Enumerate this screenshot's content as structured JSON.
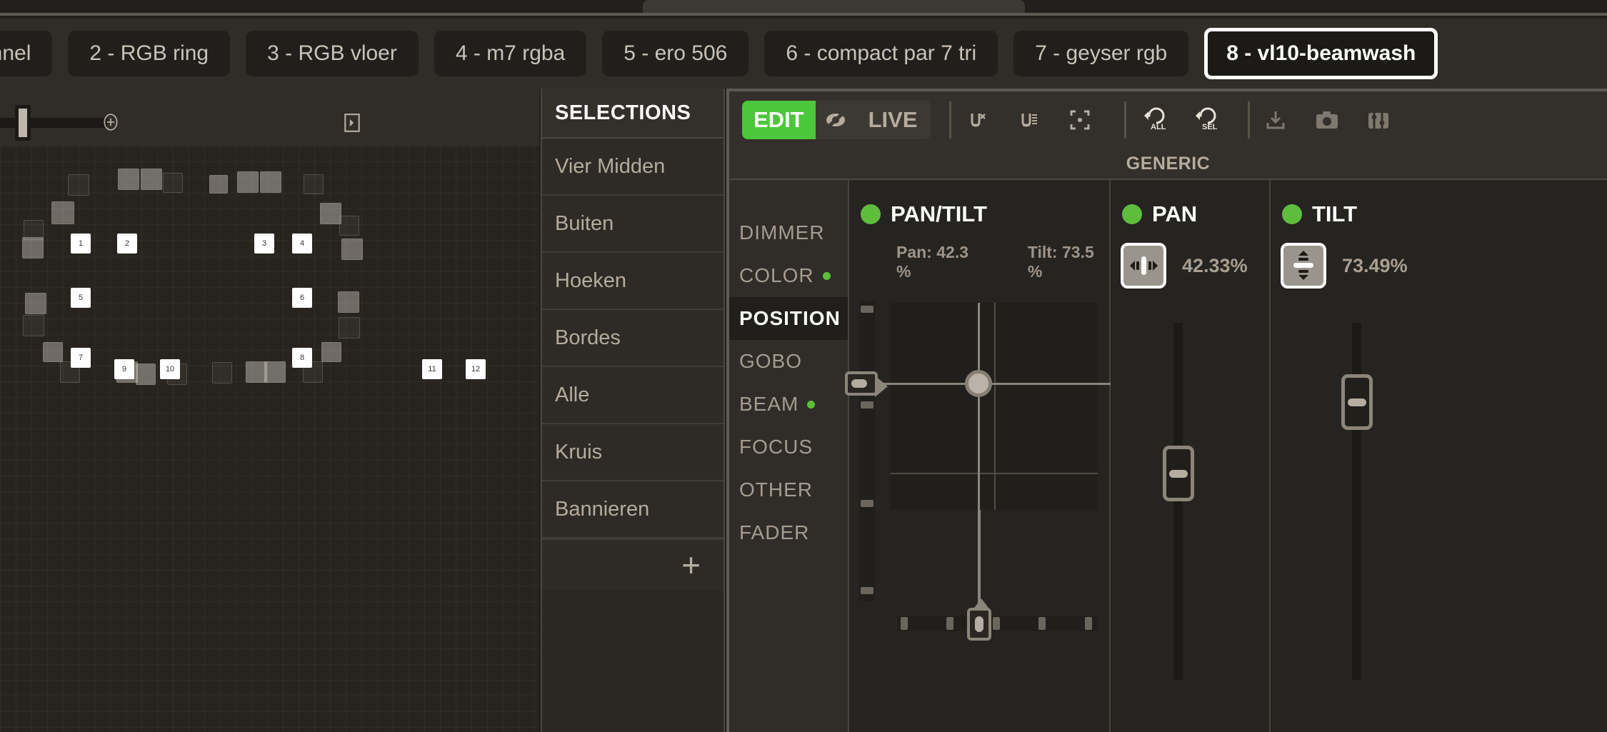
{
  "tabs": [
    {
      "label": "annel",
      "active": false,
      "truncated": true
    },
    {
      "label": "2 - RGB ring",
      "active": false
    },
    {
      "label": "3 - RGB vloer",
      "active": false
    },
    {
      "label": "4 - m7 rgba",
      "active": false
    },
    {
      "label": "5 - ero 506",
      "active": false
    },
    {
      "label": "6 - compact par 7 tri",
      "active": false
    },
    {
      "label": "7 - geyser rgb",
      "active": false
    },
    {
      "label": "8 - vl10-beamwash",
      "active": true
    }
  ],
  "stage": {
    "zoom_slider": {
      "icon_zoom_in": "plus-circle-icon",
      "icon_panel": "panel-toggle-icon",
      "value_pct": 27
    },
    "fixtures_selected": [
      "1",
      "2",
      "3",
      "4",
      "5",
      "6",
      "7",
      "8",
      "9",
      "10",
      "11",
      "12"
    ]
  },
  "selections": {
    "title": "SELECTIONS",
    "items": [
      {
        "label": "Vier Midden"
      },
      {
        "label": "Buiten"
      },
      {
        "label": "Hoeken"
      },
      {
        "label": "Bordes"
      },
      {
        "label": "Alle"
      },
      {
        "label": "Kruis"
      },
      {
        "label": "Bannieren"
      }
    ],
    "add_label": "+"
  },
  "editor": {
    "toolbar": {
      "edit_label": "EDIT",
      "live_label": "LIVE",
      "eye_icon": "eye-slash-icon",
      "mode_active": "EDIT",
      "icons": [
        {
          "name": "blind-off-icon"
        },
        {
          "name": "blind-on-icon"
        },
        {
          "name": "select-frame-icon"
        },
        {
          "name": "undo-all-icon",
          "label": "ALL"
        },
        {
          "name": "undo-selected-icon",
          "label": "SEL"
        },
        {
          "name": "download-icon"
        },
        {
          "name": "camera-icon"
        },
        {
          "name": "settings-sliders-icon"
        }
      ]
    },
    "generic_label": "GENERIC",
    "attributes": [
      {
        "label": "DIMMER",
        "has_dot": false,
        "active": false
      },
      {
        "label": "COLOR",
        "has_dot": true,
        "active": false
      },
      {
        "label": "POSITION",
        "has_dot": true,
        "active": true
      },
      {
        "label": "GOBO",
        "has_dot": false,
        "active": false
      },
      {
        "label": "BEAM",
        "has_dot": true,
        "active": false
      },
      {
        "label": "FOCUS",
        "has_dot": false,
        "active": false
      },
      {
        "label": "OTHER",
        "has_dot": false,
        "active": false
      },
      {
        "label": "FADER",
        "has_dot": false,
        "active": false
      }
    ],
    "pantilt": {
      "title": "PAN/TILT",
      "led_color": "#5fbd3e",
      "pan_readout": "Pan: 42.3 %",
      "tilt_readout": "Tilt: 73.5 %",
      "pan_pct": 42.3,
      "tilt_pct": 73.5
    },
    "pan": {
      "title": "PAN",
      "led_color": "#5fbd3e",
      "button_icon": "pan-left-right-icon",
      "value": "42.33%",
      "value_pct": 42.33
    },
    "tilt": {
      "title": "TILT",
      "led_color": "#5fbd3e",
      "button_icon": "tilt-up-down-icon",
      "value": "73.49%",
      "value_pct": 73.49
    }
  },
  "colors": {
    "accent_green": "#4cc63c",
    "led_green": "#5fbd3e",
    "panel_bg": "#2b2823",
    "canvas_bg": "#27241f",
    "text_primary": "#ffffff",
    "text_secondary": "#b5ac9e"
  }
}
